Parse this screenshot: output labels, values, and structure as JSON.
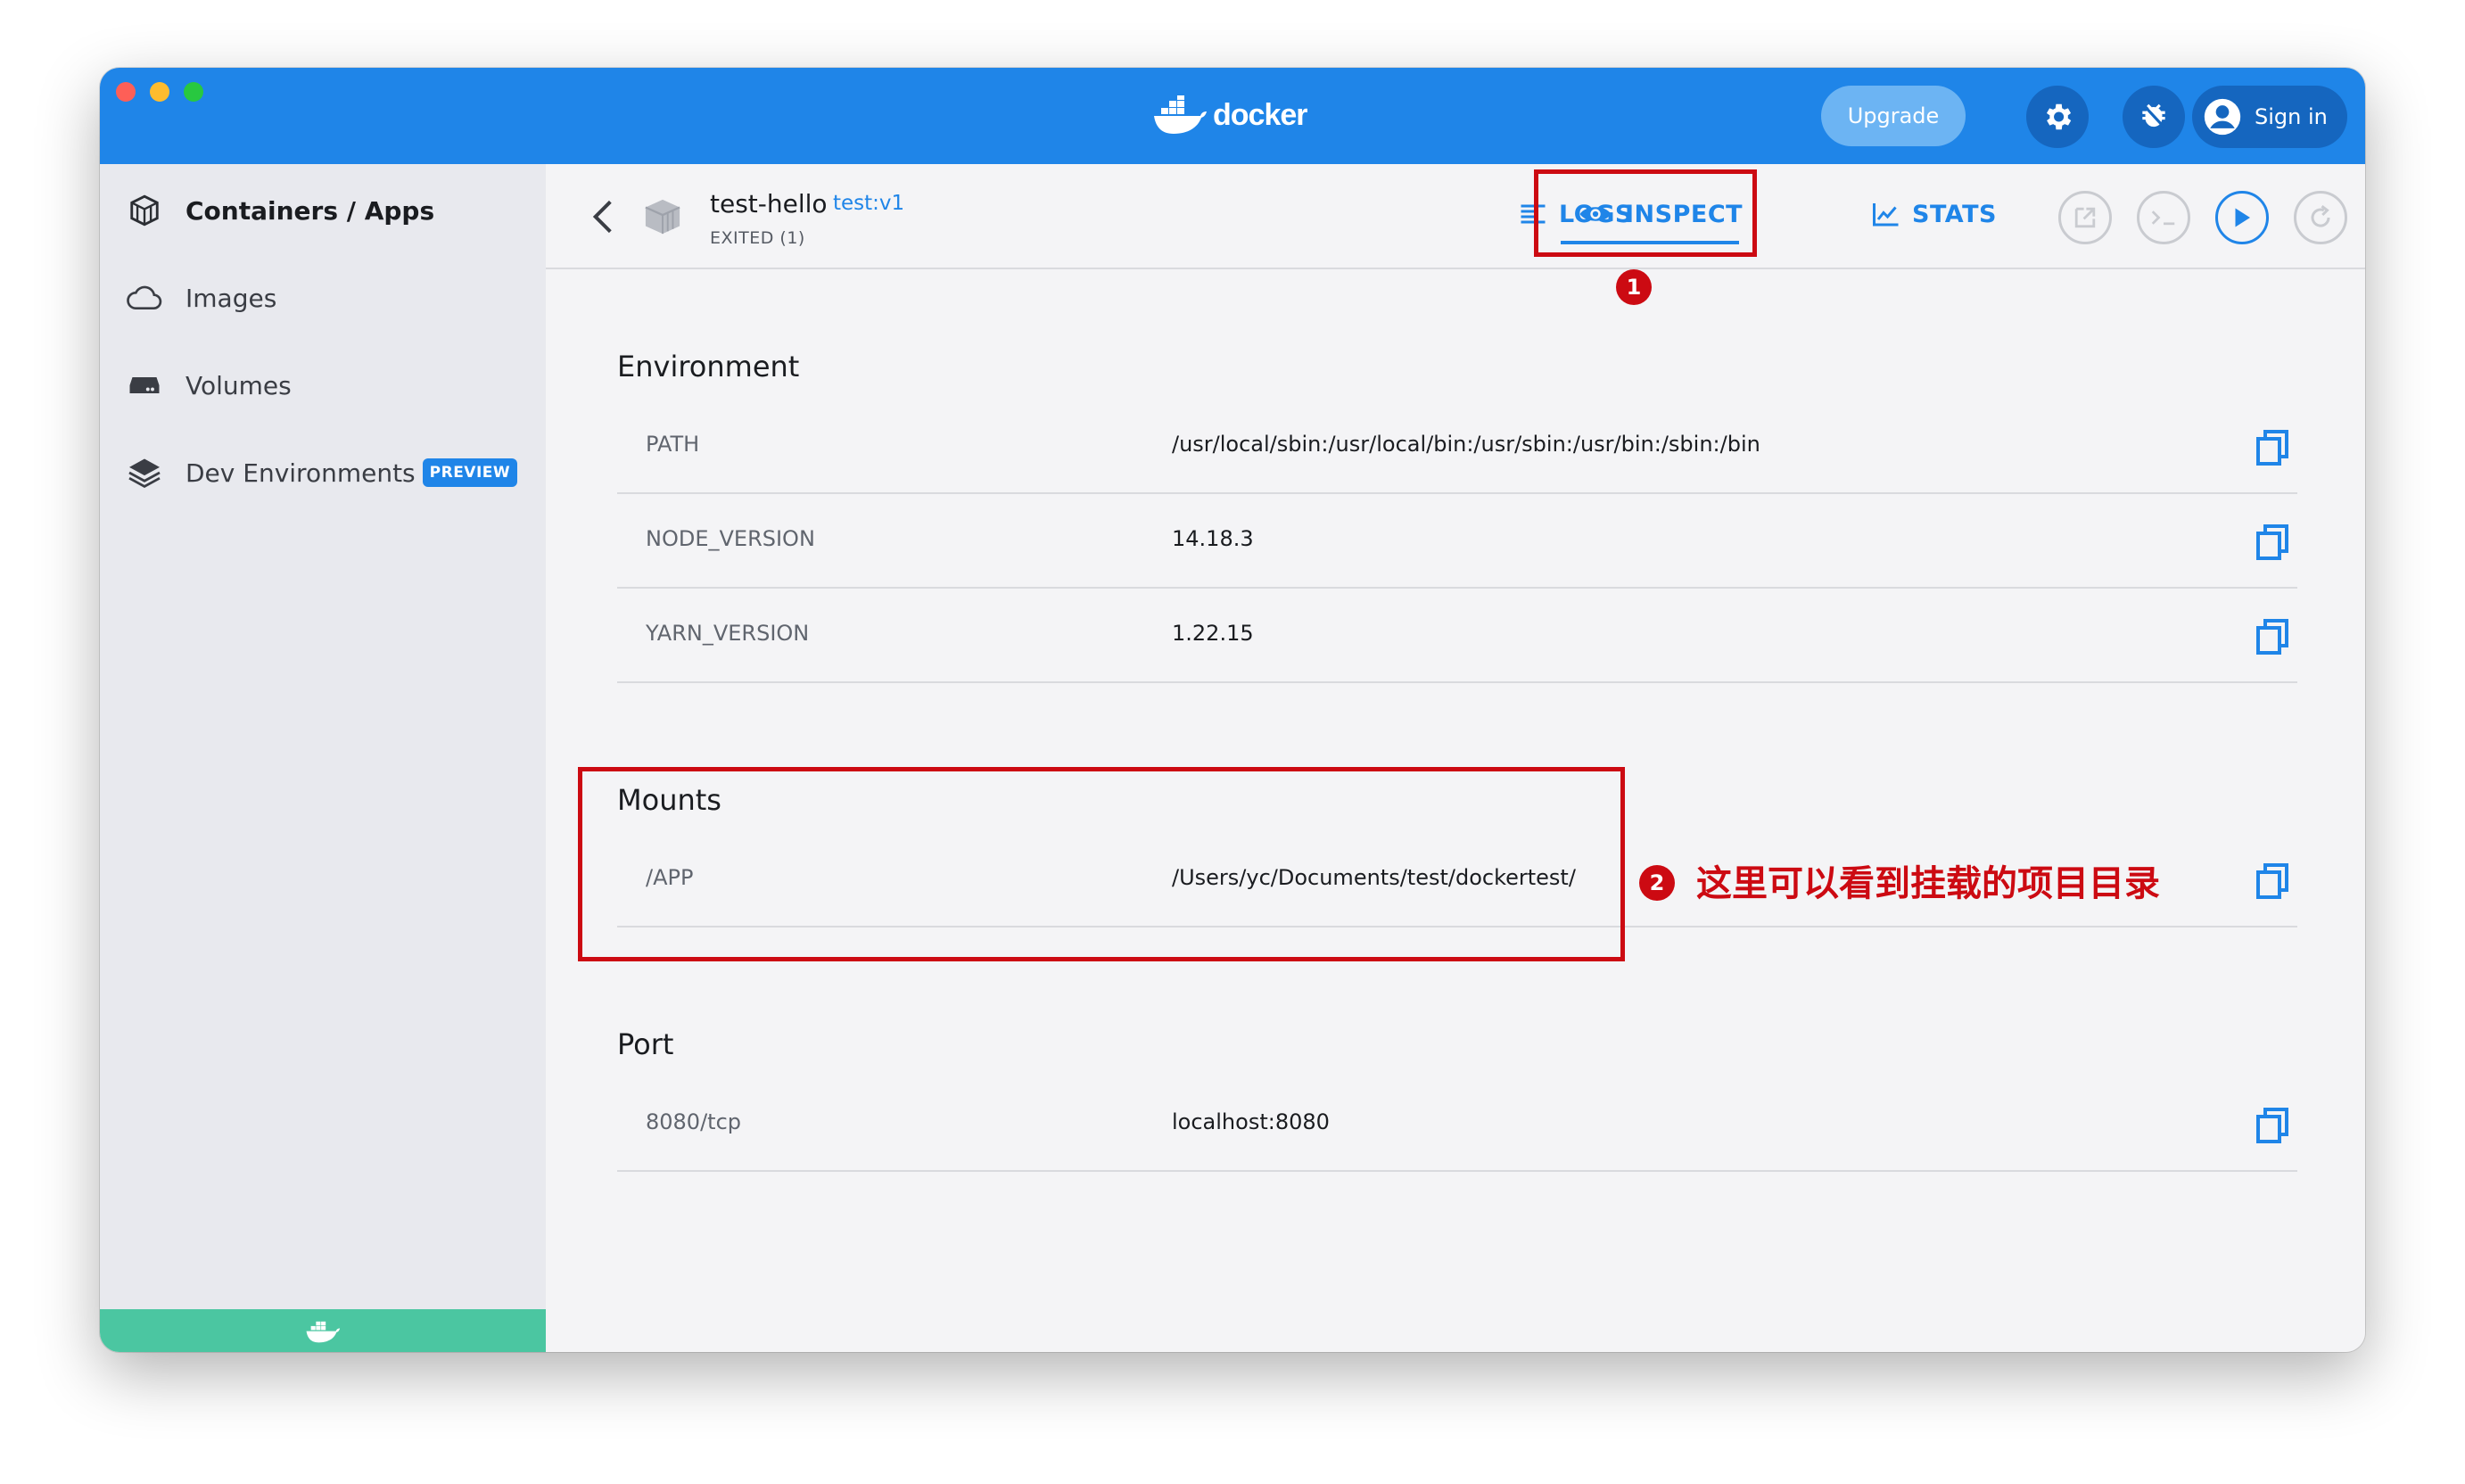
{
  "app": {
    "brand": "docker",
    "upgrade_label": "Upgrade",
    "signin_label": "Sign in",
    "accent_color": "#1f85e8"
  },
  "sidebar": {
    "items": [
      {
        "label": "Containers / Apps",
        "icon": "containers-icon",
        "active": true
      },
      {
        "label": "Images",
        "icon": "cloud-icon"
      },
      {
        "label": "Volumes",
        "icon": "volume-icon"
      },
      {
        "label": "Dev Environments",
        "icon": "layers-icon",
        "badge": "PREVIEW"
      }
    ]
  },
  "container": {
    "name": "test-hello",
    "tag": "test:v1",
    "status": "EXITED (1)"
  },
  "tabs": [
    {
      "label": "LOGS",
      "icon": "logs-icon"
    },
    {
      "label": "INSPECT",
      "icon": "eye-icon",
      "active": true
    },
    {
      "label": "STATS",
      "icon": "chart-icon"
    }
  ],
  "sections": {
    "environment": {
      "title": "Environment",
      "rows": [
        {
          "key": "PATH",
          "value": "/usr/local/sbin:/usr/local/bin:/usr/sbin:/usr/bin:/sbin:/bin"
        },
        {
          "key": "NODE_VERSION",
          "value": "14.18.3"
        },
        {
          "key": "YARN_VERSION",
          "value": "1.22.15"
        }
      ]
    },
    "mounts": {
      "title": "Mounts",
      "rows": [
        {
          "key": "/APP",
          "value": "/Users/yc/Documents/test/dockertest/"
        }
      ]
    },
    "port": {
      "title": "Port",
      "rows": [
        {
          "key": "8080/tcp",
          "value": "localhost:8080"
        }
      ]
    }
  },
  "annotations": {
    "badge1": "1",
    "badge2": "2",
    "note": "这里可以看到挂载的项目目录",
    "color": "#cc0a12"
  }
}
